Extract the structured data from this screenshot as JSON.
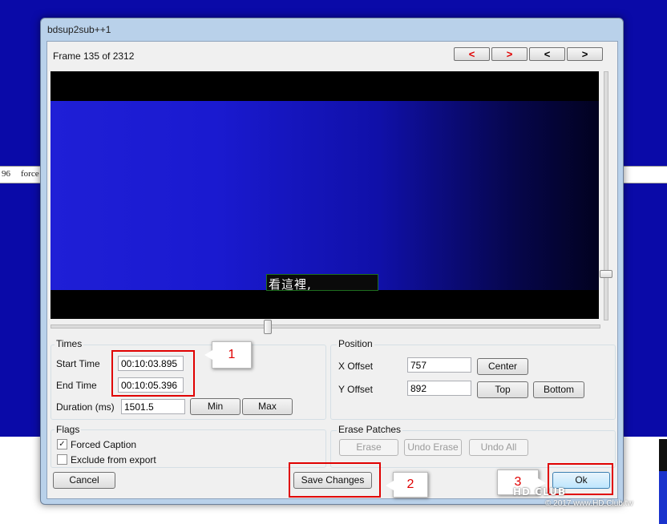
{
  "background": {
    "strip_left_text": "96",
    "strip_text": "force"
  },
  "window": {
    "title": "bdsup2sub++1"
  },
  "header": {
    "frame_label": "Frame 135 of 2312",
    "nav_buttons": [
      "<",
      ">",
      "<",
      ">"
    ]
  },
  "preview": {
    "subtitle_text": "看這裡,"
  },
  "times": {
    "group_label": "Times",
    "start_label": "Start Time",
    "start_value": "00:10:03.895",
    "end_label": "End Time",
    "end_value": "00:10:05.396",
    "duration_label": "Duration (ms)",
    "duration_value": "1501.5",
    "min_label": "Min",
    "max_label": "Max"
  },
  "position": {
    "group_label": "Position",
    "x_label": "X Offset",
    "x_value": "757",
    "y_label": "Y Offset",
    "y_value": "892",
    "center_label": "Center",
    "top_label": "Top",
    "bottom_label": "Bottom"
  },
  "flags": {
    "group_label": "Flags",
    "forced_caption_label": "Forced Caption",
    "forced_caption_checked": true,
    "exclude_label": "Exclude from export",
    "exclude_checked": false
  },
  "erase": {
    "group_label": "Erase Patches",
    "erase_label": "Erase",
    "undo_erase_label": "Undo Erase",
    "undo_all_label": "Undo All"
  },
  "footer": {
    "cancel_label": "Cancel",
    "save_label": "Save Changes",
    "ok_label": "Ok"
  },
  "annotations": {
    "callout_1": "1",
    "callout_2": "2",
    "callout_3": "3",
    "color": "#e00000"
  },
  "watermark": {
    "logo": "HD CLUB",
    "text": "© 2017 www.HD.Club.tw"
  }
}
